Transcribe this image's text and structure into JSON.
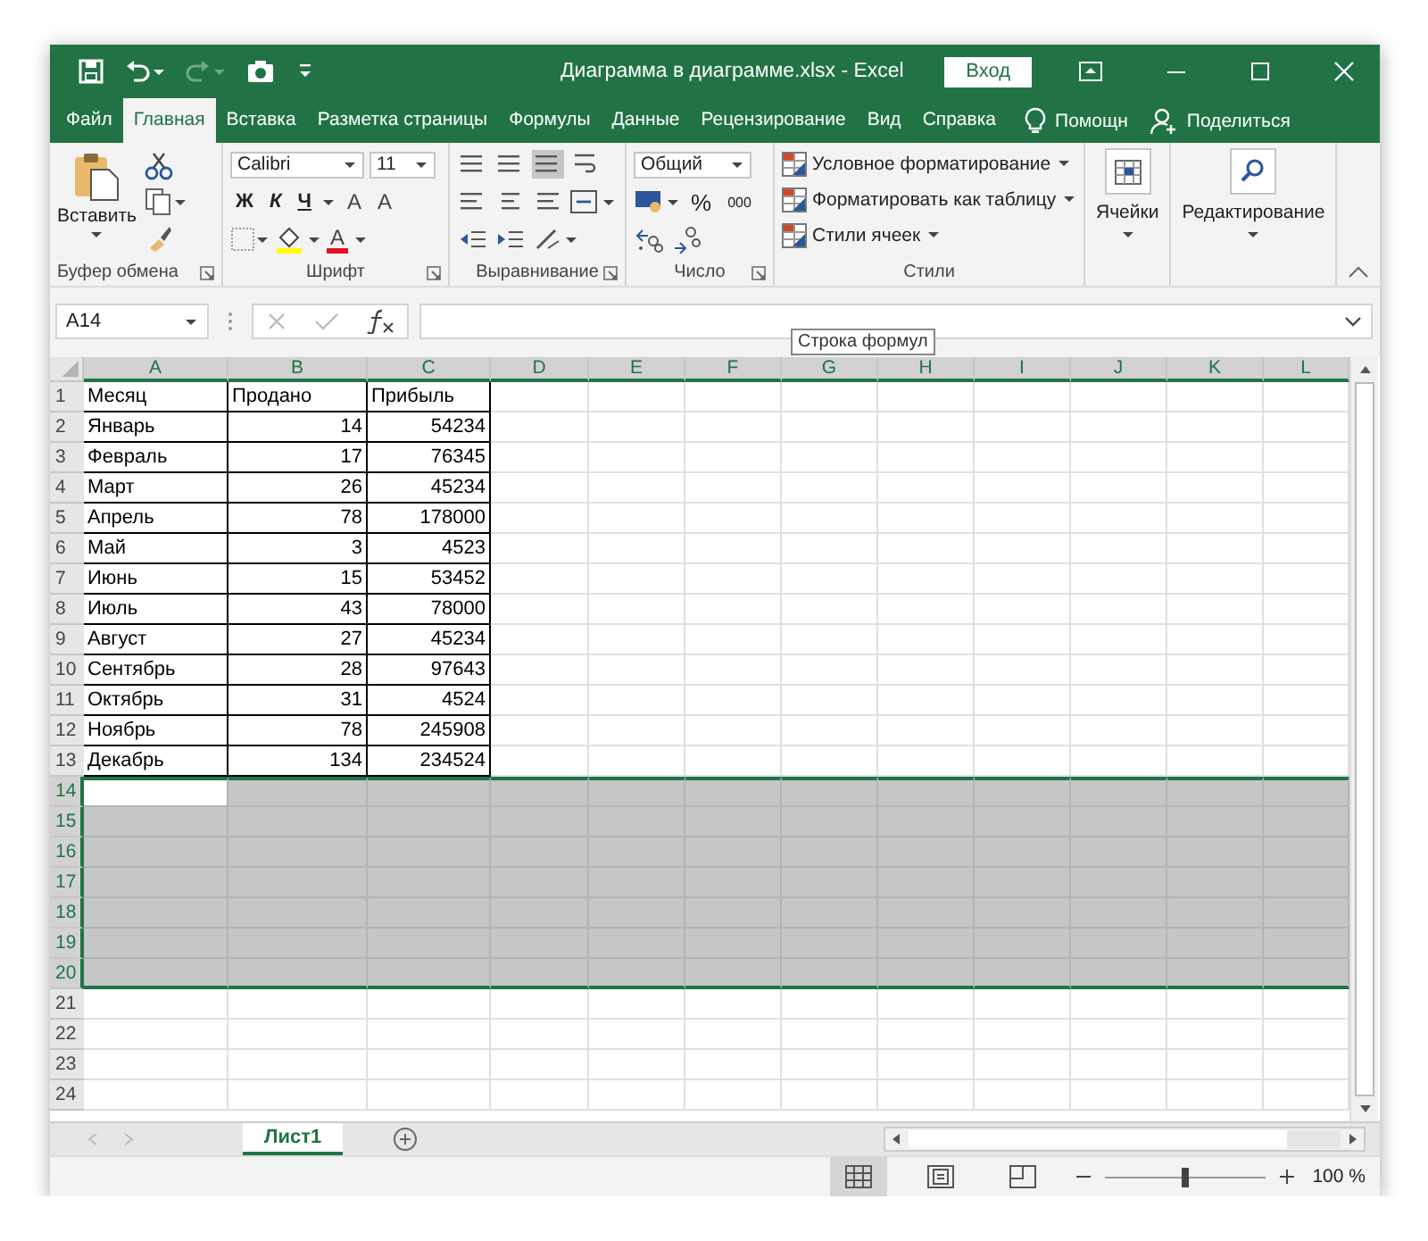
{
  "window": {
    "title": "Диаграмма в диаграмме.xlsx  -  Excel",
    "sign_in": "Вход"
  },
  "tabs": [
    {
      "label": "Файл",
      "selected": false
    },
    {
      "label": "Главная",
      "selected": true
    },
    {
      "label": "Вставка",
      "selected": false
    },
    {
      "label": "Разметка страницы",
      "selected": false
    },
    {
      "label": "Формулы",
      "selected": false
    },
    {
      "label": "Данные",
      "selected": false
    },
    {
      "label": "Рецензирование",
      "selected": false
    },
    {
      "label": "Вид",
      "selected": false
    },
    {
      "label": "Справка",
      "selected": false
    }
  ],
  "tell_me": "Помощн",
  "share": "Поделиться",
  "ribbon": {
    "groups": [
      {
        "kind": "clipboard",
        "label": "Буфер обмена",
        "launcher": true,
        "paste": "Вставить"
      },
      {
        "kind": "font",
        "label": "Шрифт",
        "launcher": true,
        "font_name": "Calibri",
        "font_size": "11",
        "styles": [
          "Ж",
          "К",
          "Ч"
        ],
        "grow": "A",
        "shrink": "A",
        "font_color": "A"
      },
      {
        "kind": "alignment",
        "label": "Выравнивание",
        "launcher": true
      },
      {
        "kind": "number",
        "label": "Число",
        "launcher": true,
        "format": "Общий",
        "percent": "%",
        "thousands": "000"
      },
      {
        "kind": "styles",
        "label": "Стили",
        "launcher": false,
        "items": [
          "Условное форматирование",
          "Форматировать как таблицу",
          "Стили ячеек"
        ]
      },
      {
        "kind": "cells",
        "label": "Ячейки"
      },
      {
        "kind": "editing",
        "label": "Редактирование"
      }
    ]
  },
  "formula_bar": {
    "name_box": "A14",
    "tooltip": "Строка формул"
  },
  "grid": {
    "columns": [
      {
        "label": "A",
        "selected": true
      },
      {
        "label": "B",
        "selected": true
      },
      {
        "label": "C",
        "selected": true
      },
      {
        "label": "D",
        "selected": true
      },
      {
        "label": "E",
        "selected": true
      },
      {
        "label": "F",
        "selected": true
      },
      {
        "label": "G",
        "selected": true
      },
      {
        "label": "H",
        "selected": true
      },
      {
        "label": "I",
        "selected": true
      },
      {
        "label": "J",
        "selected": true
      },
      {
        "label": "K",
        "selected": true
      },
      {
        "label": "L",
        "selected": true
      }
    ],
    "rows": [
      {
        "number": "1",
        "kind": "header",
        "selected": false,
        "cells": [
          "Месяц",
          "Продано",
          "Прибыль"
        ]
      },
      {
        "number": "2",
        "kind": "data",
        "selected": false,
        "cells": [
          "Январь",
          "14",
          "54234"
        ]
      },
      {
        "number": "3",
        "kind": "data",
        "selected": false,
        "cells": [
          "Февраль",
          "17",
          "76345"
        ]
      },
      {
        "number": "4",
        "kind": "data",
        "selected": false,
        "cells": [
          "Март",
          "26",
          "45234"
        ]
      },
      {
        "number": "5",
        "kind": "data",
        "selected": false,
        "cells": [
          "Апрель",
          "78",
          "178000"
        ]
      },
      {
        "number": "6",
        "kind": "data",
        "selected": false,
        "cells": [
          "Май",
          "3",
          "4523"
        ]
      },
      {
        "number": "7",
        "kind": "data",
        "selected": false,
        "cells": [
          "Июнь",
          "15",
          "53452"
        ]
      },
      {
        "number": "8",
        "kind": "data",
        "selected": false,
        "cells": [
          "Июль",
          "43",
          "78000"
        ]
      },
      {
        "number": "9",
        "kind": "data",
        "selected": false,
        "cells": [
          "Август",
          "27",
          "45234"
        ]
      },
      {
        "number": "10",
        "kind": "data",
        "selected": false,
        "cells": [
          "Сентябрь",
          "28",
          "97643"
        ]
      },
      {
        "number": "11",
        "kind": "data",
        "selected": false,
        "cells": [
          "Октябрь",
          "31",
          "4524"
        ]
      },
      {
        "number": "12",
        "kind": "data",
        "selected": false,
        "cells": [
          "Ноябрь",
          "78",
          "245908"
        ]
      },
      {
        "number": "13",
        "kind": "data",
        "selected": false,
        "cells": [
          "Декабрь",
          "134",
          "234524"
        ]
      },
      {
        "number": "14",
        "kind": "empty",
        "selected": true,
        "active": true
      },
      {
        "number": "15",
        "kind": "empty",
        "selected": true,
        "active": false
      },
      {
        "number": "16",
        "kind": "empty",
        "selected": true,
        "active": false
      },
      {
        "number": "17",
        "kind": "empty",
        "selected": true,
        "active": false
      },
      {
        "number": "18",
        "kind": "empty",
        "selected": true,
        "active": false
      },
      {
        "number": "19",
        "kind": "empty",
        "selected": true,
        "active": false
      },
      {
        "number": "20",
        "kind": "empty",
        "selected": true,
        "active": false
      },
      {
        "number": "21",
        "kind": "empty",
        "selected": false,
        "active": false
      },
      {
        "number": "22",
        "kind": "empty",
        "selected": false,
        "active": false
      },
      {
        "number": "23",
        "kind": "empty",
        "selected": false,
        "active": false
      },
      {
        "number": "24",
        "kind": "empty",
        "selected": false,
        "active": false
      }
    ]
  },
  "sheet_tabs": [
    {
      "label": "Лист1",
      "selected": true
    }
  ],
  "status_bar": {
    "views": [
      {
        "kind": "normal",
        "selected": true
      },
      {
        "kind": "page_layout",
        "selected": false
      },
      {
        "kind": "page_break",
        "selected": false
      }
    ],
    "zoom": {
      "level": 0.5,
      "reading": "100 %"
    }
  }
}
